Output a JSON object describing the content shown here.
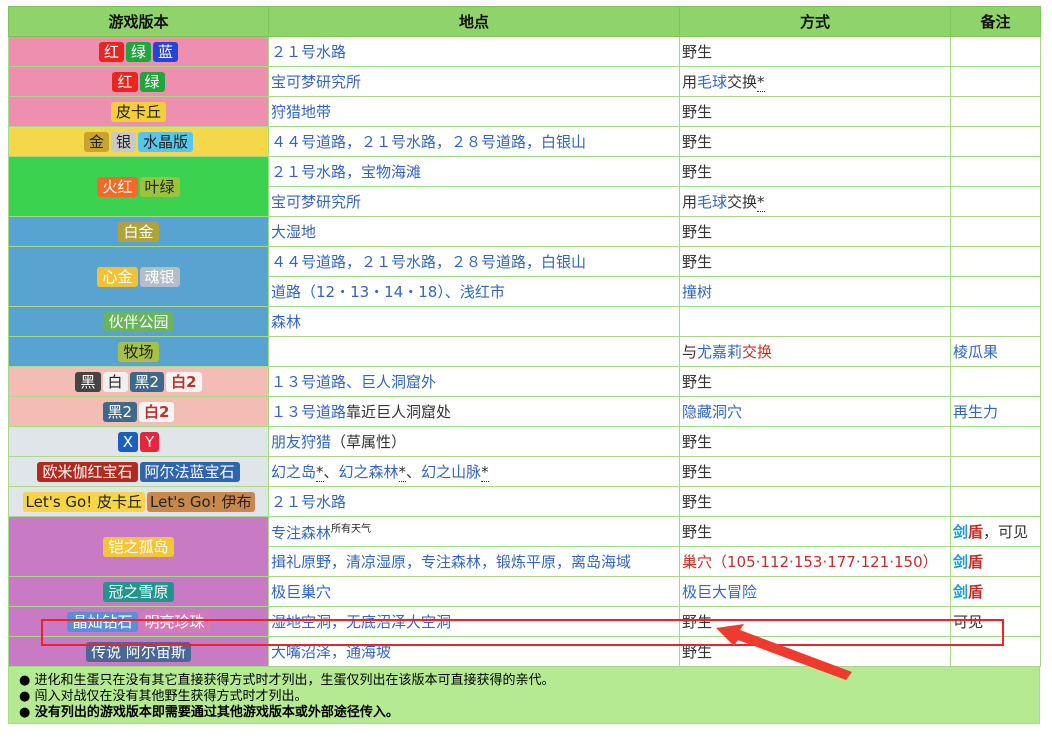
{
  "header": {
    "version": "游戏版本",
    "location": "地点",
    "method": "方式",
    "note": "备注"
  },
  "colors": {
    "header_bg": "#8fd46b",
    "row_pink": "#ef8fb0",
    "row_yellow": "#f5d84a",
    "row_green": "#3ad24e",
    "row_blue": "#58a3cf",
    "row_salmon": "#f3bcb4",
    "row_gray": "#dfe5e8",
    "row_purple": "#c97ac4",
    "highlight": "#e8262a"
  },
  "rows": {
    "r1": {
      "badges": [
        "红",
        "绿",
        "蓝"
      ],
      "location": "２１号水路",
      "method": "野生",
      "note": ""
    },
    "r2": {
      "badges": [
        "红",
        "绿"
      ],
      "location": "宝可梦研究所",
      "method_pre": "用",
      "method_link": "毛球",
      "method_post": "交换",
      "method_mark": "*",
      "note": ""
    },
    "r3": {
      "badges": [
        "皮卡丘"
      ],
      "location": "狩猎地带",
      "method": "野生",
      "note": ""
    },
    "r4": {
      "badges": [
        "金",
        "银",
        "水晶版"
      ],
      "location": "４４号道路，２１号水路，２８号道路，白银山",
      "method": "野生",
      "note": ""
    },
    "r5": {
      "badges": [
        "火红",
        "叶绿"
      ],
      "location_a": "２１号水路，宝物海滩",
      "method_a": "野生",
      "location_b": "宝可梦研究所",
      "method_b_pre": "用",
      "method_b_link": "毛球",
      "method_b_post": "交换",
      "method_b_mark": "*"
    },
    "r6": {
      "badges": [
        "白金"
      ],
      "location": "大湿地",
      "method": "野生",
      "note": ""
    },
    "r7": {
      "badges": [
        "心金",
        "魂银"
      ],
      "location_a": "４４号道路，２１号水路，２８号道路，白银山",
      "method_a": "野生",
      "location_b": "道路（12・13・14・18）、浅红市",
      "method_b": "撞树"
    },
    "r8": {
      "badges": [
        "伙伴公园"
      ],
      "location": "森林",
      "method": "",
      "note": ""
    },
    "r9": {
      "badges": [
        "牧场"
      ],
      "location": "",
      "method_pre": "与",
      "method_link": "尤嘉莉",
      "method_post": "交换",
      "note": "棱瓜果"
    },
    "r10": {
      "badges": [
        "黑",
        "白",
        "黑2",
        "白2"
      ],
      "location": "１３号道路、巨人洞窟外",
      "method": "野生",
      "note": ""
    },
    "r11": {
      "badges": [
        "黑2",
        "白2"
      ],
      "location_link": "１３号道路",
      "location_post": "靠近巨人洞窟处",
      "method": "隐藏洞穴",
      "note": "再生力"
    },
    "r12": {
      "badges": [
        "X",
        "Y"
      ],
      "location": "朋友狩猎",
      "location_post": "（草属性）",
      "method": "野生",
      "note": ""
    },
    "r13": {
      "badges": [
        "欧米伽红宝石",
        "阿尔法蓝宝石"
      ],
      "loc1": "幻之岛",
      "loc2": "幻之森林",
      "loc3": "幻之山脉",
      "mark": "*",
      "sep": "、",
      "method": "野生",
      "note": ""
    },
    "r14": {
      "badges": [
        "Let's Go! 皮卡丘",
        "Let's Go! 伊布"
      ],
      "location": "２１号水路",
      "method": "野生",
      "note": ""
    },
    "r15": {
      "badges": [
        "铠之孤岛"
      ],
      "location_a": "专注森林",
      "location_a_sup": "所有天气",
      "method_a": "野生",
      "note_a_sword": "剑",
      "note_a_shield": "盾",
      "note_a_post": "，可见",
      "location_b": "揖礼原野，清凉湿原，专注森林，锻炼平原，离岛海域",
      "method_b_link": "巢穴",
      "method_b_post": "（105·112·153·177·121·150）",
      "note_b_sword": "剑",
      "note_b_shield": "盾"
    },
    "r16": {
      "badges": [
        "冠之雪原"
      ],
      "location": "极巨巢穴",
      "method": "极巨大冒险",
      "note_sword": "剑",
      "note_shield": "盾"
    },
    "r17": {
      "badges": [
        "晶灿钻石",
        "明亮珍珠"
      ],
      "location": "湿地空洞，无底沼泽大空洞",
      "method": "野生",
      "note": "可见"
    },
    "r18": {
      "badges": [
        "传说 阿尔宙斯"
      ],
      "location": "大嘴沼泽，通海坡",
      "method": "野生",
      "note": ""
    }
  },
  "notes": [
    "进化和生蛋只在没有其它直接获得方式时才列出，生蛋仅列出在该版本可直接获得的亲代。",
    "闯入对战仅在没有其他野生获得方式时才列出。",
    "没有列出的游戏版本即需要通过其他游戏版本或外部途径传入。"
  ]
}
